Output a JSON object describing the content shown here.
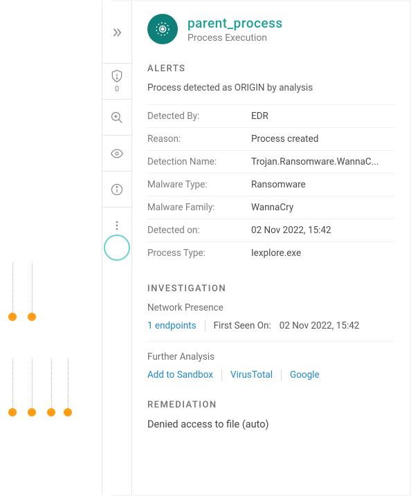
{
  "header": {
    "title": "parent_process",
    "subtitle": "Process Execution"
  },
  "iconStrip": {
    "shieldCount": "0"
  },
  "alerts": {
    "sectionTitle": "ALERTS",
    "originLine": "Process detected as ORIGIN by analysis",
    "rows": {
      "detectedByKey": "Detected By:",
      "detectedByVal": "EDR",
      "reasonKey": "Reason:",
      "reasonVal": "Process created",
      "detectionNameKey": "Detection Name:",
      "detectionNameVal": "Trojan.Ransomware.WannaC...",
      "malwareTypeKey": "Malware Type:",
      "malwareTypeVal": "Ransomware",
      "malwareFamilyKey": "Malware Family:",
      "malwareFamilyVal": "WannaCry",
      "detectedOnKey": "Detected on:",
      "detectedOnVal": "02 Nov 2022, 15:42",
      "processTypeKey": "Process Type:",
      "processTypeVal": "Iexplore.exe"
    }
  },
  "investigation": {
    "sectionTitle": "INVESTIGATION",
    "networkPresenceLabel": "Network Presence",
    "endpointsLink": "1 endpoints",
    "firstSeenLabel": "First Seen On:",
    "firstSeenVal": "02 Nov 2022, 15:42",
    "furtherAnalysisLabel": "Further Analysis",
    "links": {
      "sandbox": "Add to Sandbox",
      "virustotal": "VirusTotal",
      "google": "Google"
    }
  },
  "remediation": {
    "sectionTitle": "REMEDIATION",
    "text": "Denied access to file (auto)"
  }
}
